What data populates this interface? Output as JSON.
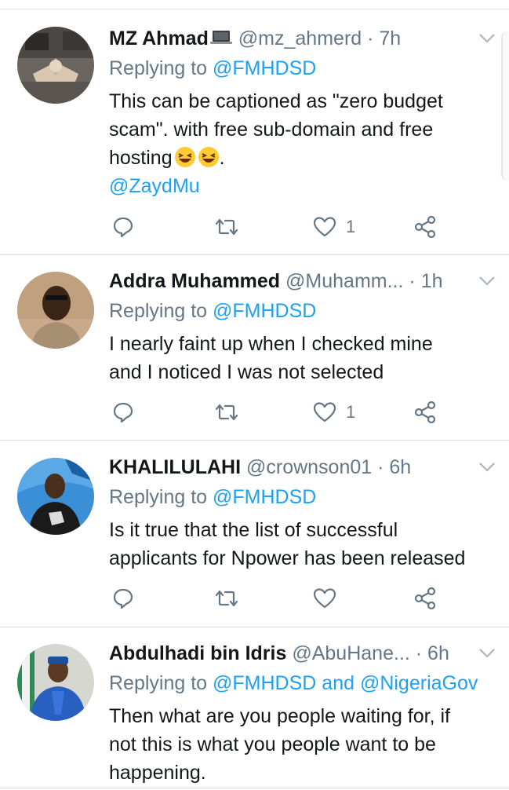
{
  "replying_prefix": "Replying to",
  "tweets": [
    {
      "name": "MZ Ahmad",
      "name_icon": "laptop-icon",
      "handle": "@mz_ahmerd",
      "separator": "·",
      "time": "7h",
      "replying": "@FMHDSD",
      "text_lines": [
        "This can be captioned as \"zero budget",
        "scam\". with free sub-domain and free",
        "hosting"
      ],
      "text_tail": ".",
      "text_emoji": [
        "laughing-emoji",
        "laughing-emoji"
      ],
      "mention_line": "@ZaydMu",
      "like_count": "1"
    },
    {
      "name": "Addra Muhammed",
      "handle": "@Muhamm...",
      "separator": "·",
      "time": "1h",
      "replying": "@FMHDSD",
      "text_lines": [
        "I nearly faint up when I checked mine",
        "and I noticed I was not selected"
      ],
      "like_count": "1"
    },
    {
      "name": "KHALILULAHI",
      "handle": "@crownson01",
      "separator": "·",
      "time": "6h",
      "replying": "@FMHDSD",
      "text_lines": [
        "Is it true that the list of successful",
        "applicants for Npower has been released"
      ],
      "like_count": ""
    },
    {
      "name": "Abdulhadi bin Idris",
      "handle": "@AbuHane...",
      "separator": "·",
      "time": "6h",
      "replying": "@FMHDSD and @NigeriaGov",
      "text_lines": [
        "Then what are you people waiting for, if",
        "not this is what you people want to be",
        "happening."
      ]
    }
  ],
  "colors": {
    "accent": "#1da1f2",
    "secondary_text": "#657786",
    "primary_text": "#14171a",
    "divider": "#d6dde2"
  }
}
